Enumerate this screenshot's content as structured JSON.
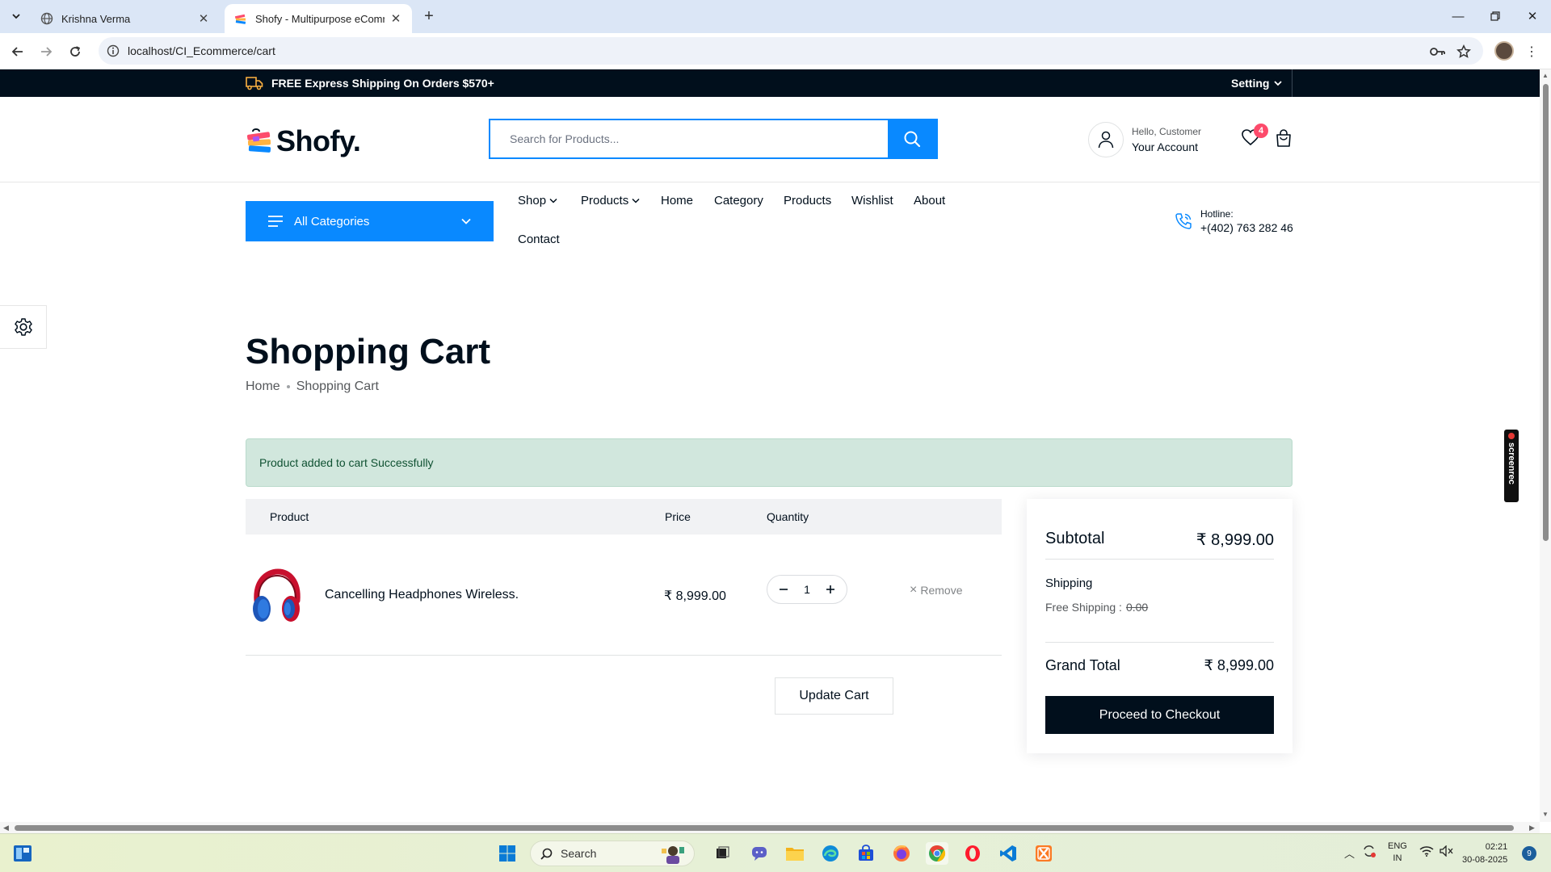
{
  "browser": {
    "tabs": [
      {
        "title": "Krishna Verma",
        "active": false
      },
      {
        "title": "Shofy - Multipurpose eCommer",
        "active": true
      }
    ],
    "url": "localhost/CI_Ecommerce/cart"
  },
  "promo": {
    "shipping_text": "FREE Express Shipping On Orders $570+",
    "setting_label": "Setting"
  },
  "header": {
    "logo_text": "Shofy.",
    "search_placeholder": "Search for Products...",
    "account_greeting": "Hello, Customer",
    "account_label": "Your Account",
    "wishlist_count": "4"
  },
  "nav": {
    "all_categories": "All Categories",
    "items": [
      "Shop",
      "Products",
      "Home",
      "Category",
      "Products",
      "Wishlist",
      "About",
      "Contact"
    ],
    "hotline_label": "Hotline:",
    "hotline_number": "+(402) 763 282 46"
  },
  "page": {
    "title": "Shopping Cart",
    "breadcrumb": [
      "Home",
      "Shopping Cart"
    ],
    "alert": "Product added to cart Successfully"
  },
  "cart": {
    "columns": [
      "Product",
      "Price",
      "Quantity"
    ],
    "items": [
      {
        "name": "Cancelling Headphones Wireless.",
        "price": "₹ 8,999.00",
        "quantity": "1",
        "remove_label": "Remove"
      }
    ],
    "update_label": "Update Cart"
  },
  "summary": {
    "subtotal_label": "Subtotal",
    "subtotal_value": "₹ 8,999.00",
    "shipping_label": "Shipping",
    "free_shipping_label": "Free Shipping :",
    "free_shipping_value": "0.00",
    "grand_total_label": "Grand Total",
    "grand_total_value": "₹ 8,999.00",
    "checkout_label": "Proceed to Checkout"
  },
  "overlay": {
    "screenrec_label": "screenrec"
  },
  "taskbar": {
    "search_label": "Search",
    "lang_top": "ENG",
    "lang_bottom": "IN",
    "time": "02:21",
    "date": "30-08-2025",
    "notification_count": "9"
  },
  "colors": {
    "accent": "#0989ff",
    "dark": "#010f1c",
    "badge": "#fd4b6b",
    "alert_bg": "#d1e7dd"
  }
}
